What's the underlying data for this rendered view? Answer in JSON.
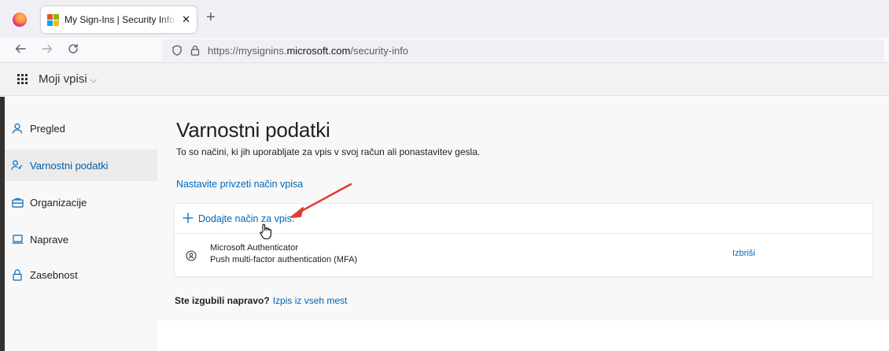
{
  "browser": {
    "tab_title": "My Sign-Ins | Security Info | Microsoft",
    "tab_close": "✕",
    "new_tab": "+",
    "url_prefix": "https://mysignins.",
    "url_domain": "microsoft.com",
    "url_path": "/security-info"
  },
  "app": {
    "name": "Moji vpisi",
    "chevron": "⌵"
  },
  "sidebar": {
    "items": [
      {
        "label": "Pregled",
        "icon": "person-icon"
      },
      {
        "label": "Varnostni podatki",
        "icon": "security-info-icon"
      },
      {
        "label": "Organizacije",
        "icon": "briefcase-icon"
      },
      {
        "label": "Naprave",
        "icon": "laptop-icon"
      },
      {
        "label": "Zasebnost",
        "icon": "lock-icon"
      }
    ]
  },
  "main": {
    "title": "Varnostni podatki",
    "subtitle": "To so načini, ki jih uporabljate za vpis v svoj račun ali ponastavitev gesla.",
    "default_link": "Nastavite privzeti način vpisa",
    "add_method": "Dodajte način za vpis.",
    "method": {
      "name": "Microsoft Authenticator",
      "description": "Push multi-factor authentication (MFA)",
      "delete": "Izbriši"
    },
    "lost_question": "Ste izgubili napravo?",
    "lost_link": "Izpis iz vseh mest"
  },
  "colors": {
    "link": "#0067b8",
    "annotation_arrow": "#e03c31"
  }
}
